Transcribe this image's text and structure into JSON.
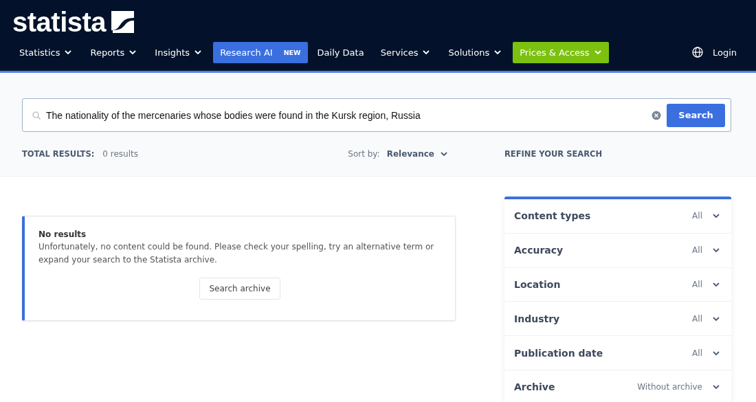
{
  "header": {
    "logo": "statista",
    "nav": [
      {
        "kind": "menu",
        "label": "Statistics"
      },
      {
        "kind": "menu",
        "label": "Reports"
      },
      {
        "kind": "menu",
        "label": "Insights"
      },
      {
        "kind": "ai",
        "label": "Research AI",
        "badge": "NEW"
      },
      {
        "kind": "link",
        "label": "Daily Data"
      },
      {
        "kind": "menu",
        "label": "Services"
      },
      {
        "kind": "menu",
        "label": "Solutions"
      },
      {
        "kind": "cta",
        "label": "Prices & Access"
      }
    ],
    "login": "Login"
  },
  "search": {
    "value": "The nationality of the mercenaries whose bodies were found in the Kursk region, Russia",
    "button": "Search"
  },
  "results_bar": {
    "total_label": "TOTAL RESULTS:",
    "total": "0 results",
    "sort_label": "Sort by:",
    "sort_value": "Relevance",
    "refine_title": "REFINE YOUR SEARCH"
  },
  "message": {
    "title": "No results",
    "text": "Unfortunately, no content could be found. Please check your spelling, try an alternative term or expand your search to the Statista archive.",
    "button": "Search archive"
  },
  "filters": [
    {
      "label": "Content types",
      "value": "All"
    },
    {
      "label": "Accuracy",
      "value": "All"
    },
    {
      "label": "Location",
      "value": "All"
    },
    {
      "label": "Industry",
      "value": "All"
    },
    {
      "label": "Publication date",
      "value": "All"
    },
    {
      "label": "Archive",
      "value": "Without archive"
    }
  ]
}
